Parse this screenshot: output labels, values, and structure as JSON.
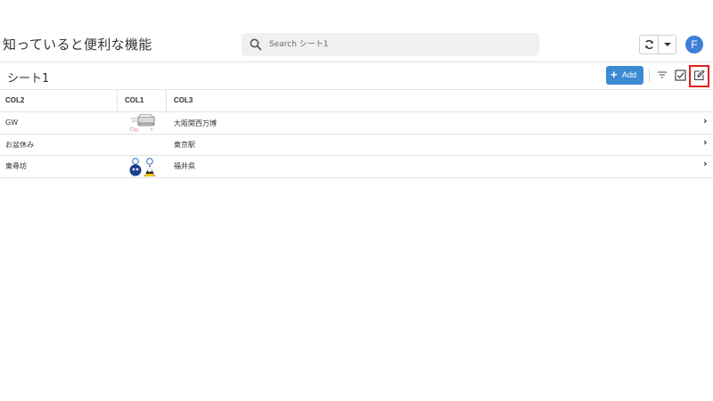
{
  "header": {
    "title": "知っていると便利な機能",
    "search": {
      "placeholder": "Search シート1",
      "value": ""
    },
    "sync_icon": "sync-icon",
    "dropdown_icon": "caret-down-icon",
    "avatar_initial": "F",
    "avatar_color": "#3d7fd6"
  },
  "sheet": {
    "title": "シート1",
    "add_label": "Add",
    "add_color": "#3d8ad4",
    "toolbar_icons": [
      "filter-icon",
      "checkbox-icon",
      "edit-icon"
    ],
    "highlight_color": "#e02020"
  },
  "table": {
    "columns": [
      "COL2",
      "COL1",
      "COL3"
    ],
    "rows": [
      {
        "col2": "GW",
        "col1_image": "printer-sketch",
        "col3": "大阪関西万博"
      },
      {
        "col2": "お盆休み",
        "col1_image": "",
        "col3": "東京駅"
      },
      {
        "col2": "東尋坊",
        "col1_image": "mascots",
        "col3": "福井県"
      }
    ]
  }
}
